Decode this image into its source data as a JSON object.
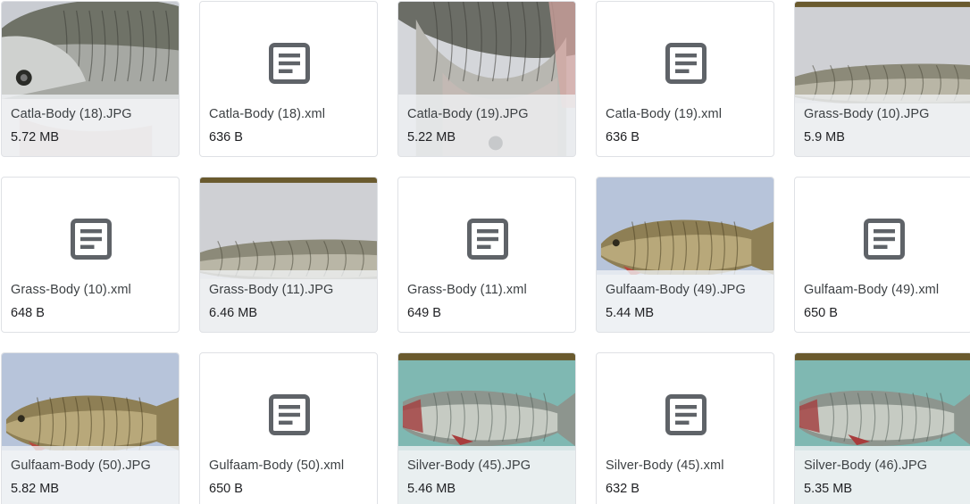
{
  "files": [
    {
      "name": "Catla-Body (18).JPG",
      "size": "5.72 MB",
      "kind": "image",
      "thumb": "catla-head",
      "icon": "fish-photo"
    },
    {
      "name": "Catla-Body (18).xml",
      "size": "636 B",
      "kind": "document",
      "icon": "document-icon"
    },
    {
      "name": "Catla-Body (19).JPG",
      "size": "5.22 MB",
      "kind": "image",
      "thumb": "catla-closeup",
      "icon": "fish-photo"
    },
    {
      "name": "Catla-Body (19).xml",
      "size": "636 B",
      "kind": "document",
      "icon": "document-icon"
    },
    {
      "name": "Grass-Body (10).JPG",
      "size": "5.9 MB",
      "kind": "image",
      "thumb": "grass-gray",
      "icon": "fish-photo"
    },
    {
      "name": "Grass-Body (10).xml",
      "size": "648 B",
      "kind": "document",
      "icon": "document-icon"
    },
    {
      "name": "Grass-Body (11).JPG",
      "size": "6.46 MB",
      "kind": "image",
      "thumb": "grass-gray",
      "icon": "fish-photo"
    },
    {
      "name": "Grass-Body (11).xml",
      "size": "649 B",
      "kind": "document",
      "icon": "document-icon"
    },
    {
      "name": "Gulfaam-Body (49).JPG",
      "size": "5.44 MB",
      "kind": "image",
      "thumb": "gulfaam-blue",
      "icon": "fish-photo"
    },
    {
      "name": "Gulfaam-Body (49).xml",
      "size": "650 B",
      "kind": "document",
      "icon": "document-icon"
    },
    {
      "name": "Gulfaam-Body (50).JPG",
      "size": "5.82 MB",
      "kind": "image",
      "thumb": "gulfaam-blue",
      "icon": "fish-photo"
    },
    {
      "name": "Gulfaam-Body (50).xml",
      "size": "650 B",
      "kind": "document",
      "icon": "document-icon"
    },
    {
      "name": "Silver-Body (45).JPG",
      "size": "5.46 MB",
      "kind": "image",
      "thumb": "silver-teal",
      "icon": "fish-photo"
    },
    {
      "name": "Silver-Body (45).xml",
      "size": "632 B",
      "kind": "document",
      "icon": "document-icon"
    },
    {
      "name": "Silver-Body (46).JPG",
      "size": "5.35 MB",
      "kind": "image",
      "thumb": "silver-teal",
      "icon": "fish-photo"
    }
  ],
  "colors": {
    "border": "#dfe1e5",
    "icon": "#5f6368",
    "name_text": "#3c4043",
    "size_text": "#202124"
  }
}
